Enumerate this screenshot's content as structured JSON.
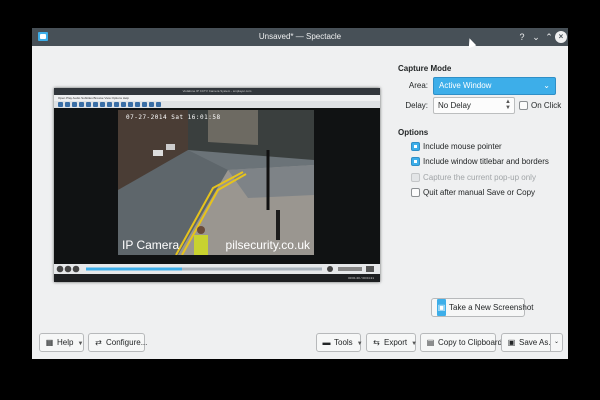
{
  "window": {
    "title": "Unsaved* — Spectacle",
    "titlebar_buttons": [
      "?",
      "⌄",
      "⌃",
      "×"
    ]
  },
  "preview": {
    "inner_title": "Vodafone IP CCTV Camera System - smplayer.com",
    "inner_menu": "Open  Play  Audio  Subtitles  Browse  View  Options  Help",
    "timestamp": "07-27-2014 Sat 16:01:58",
    "overlay_left": "IP Camera",
    "overlay_right": "pilsecurity.co.uk",
    "status_time": "00:01:20 / 00:04:21"
  },
  "capture_mode": {
    "title": "Capture Mode",
    "area_label": "Area:",
    "area_value": "Active Window",
    "delay_label": "Delay:",
    "delay_value": "No Delay",
    "on_click_label": "On Click",
    "on_click_checked": false
  },
  "options": {
    "title": "Options",
    "items": [
      {
        "label": "Include mouse pointer",
        "checked": true,
        "enabled": true
      },
      {
        "label": "Include window titlebar and borders",
        "checked": true,
        "enabled": true
      },
      {
        "label": "Capture the current pop-up only",
        "checked": false,
        "enabled": false
      },
      {
        "label": "Quit after manual Save or Copy",
        "checked": false,
        "enabled": true
      }
    ]
  },
  "new_screenshot_button": "Take a New Screenshot",
  "bottom_bar": {
    "help": "Help",
    "configure": "Configure...",
    "tools": "Tools",
    "export": "Export",
    "copy": "Copy to Clipboard",
    "save_as": "Save As..."
  },
  "colors": {
    "titlebar": "#475057",
    "window_bg": "#eff0f1",
    "accent": "#3daee9"
  }
}
